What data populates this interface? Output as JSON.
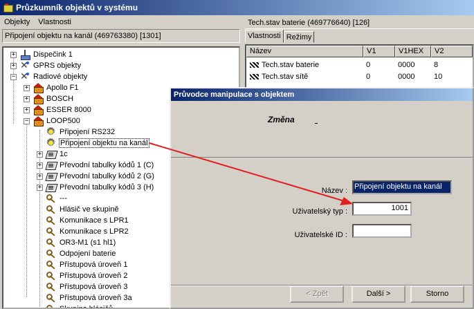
{
  "window": {
    "title": "Průzkumník objektů v systému"
  },
  "menu": {
    "items": [
      "Objekty",
      "Vlastnosti"
    ]
  },
  "left_panel": {
    "header": "Připojení objektu na kanál  (469763380) [1301]"
  },
  "tree": {
    "items": [
      {
        "label": "Dispečink 1",
        "icon": "tower-icon",
        "expander": "+"
      },
      {
        "label": "GPRS objekty",
        "icon": "gprs-icon",
        "expander": "+"
      },
      {
        "label": "Radiové objekty",
        "icon": "gprs-icon",
        "expander": "-"
      },
      {
        "label": "Apollo F1",
        "icon": "building-icon",
        "expander": "+"
      },
      {
        "label": "BOSCH",
        "icon": "building-icon",
        "expander": "+"
      },
      {
        "label": "ESSER 8000",
        "icon": "building-icon",
        "expander": "+"
      },
      {
        "label": "LOOP500",
        "icon": "building-icon",
        "expander": "-"
      },
      {
        "label": "Připojení RS232",
        "icon": "connection-icon",
        "expander": ""
      },
      {
        "label": "Připojení objektu na kanál",
        "icon": "connection-icon",
        "expander": "",
        "selected": true
      },
      {
        "label": "1c",
        "icon": "table-icon",
        "expander": "+"
      },
      {
        "label": "Převodní tabulky kódů 1 (C)",
        "icon": "table-icon",
        "expander": "+"
      },
      {
        "label": "Převodní tabulky kódů 2 (G)",
        "icon": "table-icon",
        "expander": "+"
      },
      {
        "label": "Převodní tabulky kódů 3 (H)",
        "icon": "table-icon",
        "expander": "+"
      },
      {
        "label": "---",
        "icon": "key-icon",
        "expander": ""
      },
      {
        "label": "Hlásič ve skupině",
        "icon": "key-icon",
        "expander": ""
      },
      {
        "label": "Komunikace s LPR1",
        "icon": "key-icon",
        "expander": ""
      },
      {
        "label": "Komunikace s LPR2",
        "icon": "key-icon",
        "expander": ""
      },
      {
        "label": "OR3-M1 (s1 hl1)",
        "icon": "key-icon",
        "expander": ""
      },
      {
        "label": "Odpojení baterie",
        "icon": "key-icon",
        "expander": ""
      },
      {
        "label": "Přístupová úroveň 1",
        "icon": "key-icon",
        "expander": ""
      },
      {
        "label": "Přístupová úroveň 2",
        "icon": "key-icon",
        "expander": ""
      },
      {
        "label": "Přístupová úroveň 3",
        "icon": "key-icon",
        "expander": ""
      },
      {
        "label": "Přístupová úroveň 3a",
        "icon": "key-icon",
        "expander": ""
      },
      {
        "label": "Skupina hlásičů",
        "icon": "key-icon",
        "expander": ""
      }
    ]
  },
  "right_panel": {
    "header": "Tech.stav baterie  (469776640) [126]",
    "tabs": [
      "Vlastnosti",
      "Režimy"
    ],
    "columns": [
      "Název",
      "V1",
      "V1HEX",
      "V2"
    ],
    "rows": [
      {
        "name": "Tech.stav baterie",
        "v1": "0",
        "v1hex": "0000",
        "v2": "8"
      },
      {
        "name": "Tech.stav sítě",
        "v1": "0",
        "v1hex": "0000",
        "v2": "10"
      }
    ]
  },
  "dialog": {
    "title": "Průvodce manipulace s objektem",
    "step": "Změna",
    "fields": {
      "name_label": "Název :",
      "name_value": "Připojení objektu na kanál",
      "user_type_label": "Uživatelský typ :",
      "user_type_value": "1001",
      "user_id_label": "Uživatelské ID :",
      "user_id_value": ""
    },
    "buttons": {
      "back": "< Zpět",
      "next": "Další >",
      "cancel": "Storno"
    }
  },
  "colors": {
    "annotation_arrow": "#e02020",
    "title_bar": "#0a246a",
    "selection": "#0a246a"
  }
}
